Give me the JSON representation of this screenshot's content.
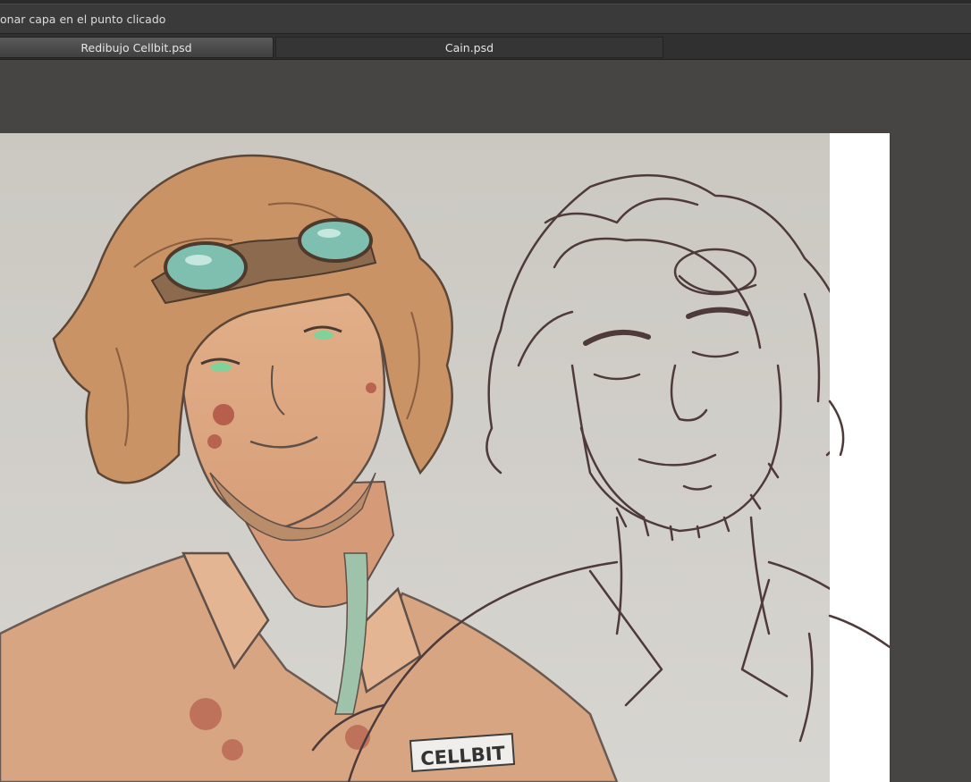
{
  "options_bar": {
    "hint_text": "onar capa en el punto clicado"
  },
  "tabs": [
    {
      "label": "Redibujo Cellbit.psd",
      "active": true
    },
    {
      "label": "Cain.psd",
      "active": false
    }
  ],
  "artwork": {
    "badge_text": "CELLBIT"
  },
  "colors": {
    "workspace_bg": "#464544",
    "tab_active": "#4f4f4f",
    "canvas_bg": "#ffffff",
    "sketch_line": "#4e3a3a"
  }
}
